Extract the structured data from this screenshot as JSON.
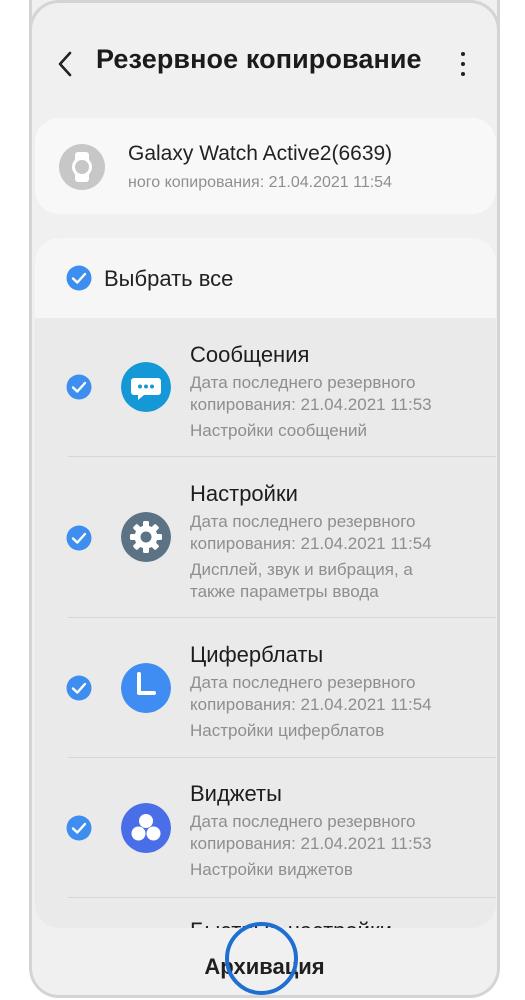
{
  "header": {
    "title": "Резервное копирование",
    "back_icon": "chevron-left-icon",
    "more_icon": "more-vertical-icon"
  },
  "device": {
    "icon": "watch-icon",
    "name": "Galaxy Watch Active2(6639)",
    "last_backup": "ного копирования: 21.04.2021 11:54"
  },
  "select_all": {
    "label": "Выбрать все",
    "checked": true
  },
  "items": [
    {
      "title": "Сообщения",
      "line1": "Дата последнего резервного",
      "line2": "копирования: 21.04.2021 11:53",
      "line3": "Настройки сообщений",
      "icon": "message-icon",
      "color": "#1499d6",
      "checked": true
    },
    {
      "title": "Настройки",
      "line1": "Дата последнего резервного",
      "line2": "копирования: 21.04.2021 11:54",
      "line3": "Дисплей, звук и вибрация, а",
      "line4": "также параметры ввода",
      "icon": "gear-icon",
      "color": "#5b7384",
      "checked": true
    },
    {
      "title": "Циферблаты",
      "line1": "Дата последнего резервного",
      "line2": "копирования: 21.04.2021 11:54",
      "line3": "Настройки циферблатов",
      "icon": "clock-icon",
      "color": "#3f8df3",
      "checked": true
    },
    {
      "title": "Виджеты",
      "line1": "Дата последнего резервного",
      "line2": "копирования: 21.04.2021 11:53",
      "line3": "Настройки виджетов",
      "icon": "widgets-icon",
      "color": "#4a6ee8",
      "checked": true
    },
    {
      "title": "Быстрые настройки"
    }
  ],
  "bottom": {
    "button_label": "Архивация"
  },
  "colors": {
    "accent": "#3e8ef0",
    "highlight": "#1e6fcf"
  }
}
